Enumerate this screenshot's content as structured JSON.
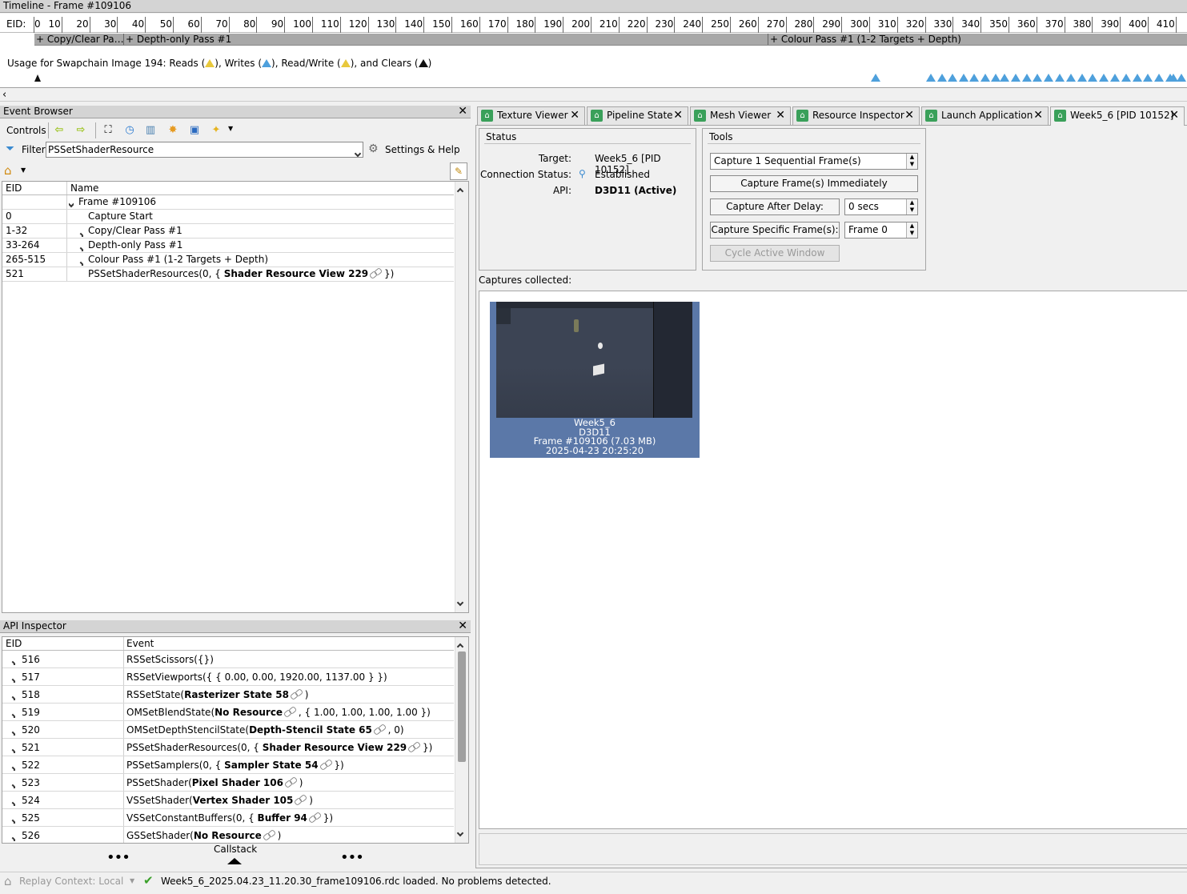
{
  "timeline": {
    "title": "Timeline - Frame #109106",
    "eid_label": "EID:",
    "ticks": [
      "0",
      "10",
      "20",
      "30",
      "40",
      "50",
      "60",
      "70",
      "80",
      "90",
      "100",
      "110",
      "120",
      "130",
      "140",
      "150",
      "160",
      "170",
      "180",
      "190",
      "200",
      "210",
      "220",
      "230",
      "240",
      "250",
      "260",
      "270",
      "280",
      "290",
      "300",
      "310",
      "320",
      "330",
      "340",
      "350",
      "360",
      "370",
      "380",
      "390",
      "400",
      "410"
    ],
    "markers": [
      "+ Copy/Clear Pa…",
      "+ Depth-only Pass #1",
      "+ Colour Pass #1 (1-2 Targets + Depth)"
    ],
    "usage_text": "Usage for Swapchain Image 194: Reads (",
    "usage_writes": "), Writes (",
    "usage_rw": "), Read/Write (",
    "usage_clears": "), and Clears (",
    "usage_end": ")"
  },
  "event_browser": {
    "title": "Event Browser",
    "controls_label": "Controls",
    "filter_label": "Filter",
    "filter_value": "PSSetShaderResource",
    "settings_label": "Settings & Help",
    "col_eid": "EID",
    "col_name": "Name",
    "rows": [
      {
        "eid": "",
        "name": "Frame #109106"
      },
      {
        "eid": "0",
        "name": "Capture Start"
      },
      {
        "eid": "1-32",
        "name": "Copy/Clear Pass #1"
      },
      {
        "eid": "33-264",
        "name": "Depth-only Pass #1"
      },
      {
        "eid": "265-515",
        "name": "Colour Pass #1 (1-2 Targets + Depth)"
      },
      {
        "eid": "521",
        "name_pre": "PSSetShaderResources(0, { ",
        "name_bold": "Shader Resource View 229",
        "name_post": " })"
      }
    ]
  },
  "api_inspector": {
    "title": "API Inspector",
    "col_eid": "EID",
    "col_event": "Event",
    "rows": [
      {
        "eid": "516",
        "pre": "RSSetScissors({})",
        "bold": "",
        "post": ""
      },
      {
        "eid": "517",
        "pre": "RSSetViewports({ { 0.00, 0.00, 1920.00, 1137.00 } })",
        "bold": "",
        "post": ""
      },
      {
        "eid": "518",
        "pre": "RSSetState(",
        "bold": "Rasterizer State 58",
        "post": " )"
      },
      {
        "eid": "519",
        "pre": "OMSetBlendState(",
        "bold": "No Resource",
        "post": " , { 1.00, 1.00, 1.00, 1.00 })"
      },
      {
        "eid": "520",
        "pre": "OMSetDepthStencilState(",
        "bold": "Depth-Stencil State 65",
        "post": " , 0)"
      },
      {
        "eid": "521",
        "pre": "PSSetShaderResources(0, { ",
        "bold": "Shader Resource View 229",
        "post": "  })"
      },
      {
        "eid": "522",
        "pre": "PSSetSamplers(0, { ",
        "bold": "Sampler State 54",
        "post": "  })"
      },
      {
        "eid": "523",
        "pre": "PSSetShader(",
        "bold": "Pixel Shader 106",
        "post": " )"
      },
      {
        "eid": "524",
        "pre": "VSSetShader(",
        "bold": "Vertex Shader 105",
        "post": " )"
      },
      {
        "eid": "525",
        "pre": "VSSetConstantBuffers(0, { ",
        "bold": "Buffer 94",
        "post": "  })"
      },
      {
        "eid": "526",
        "pre": "GSSetShader(",
        "bold": "No Resource",
        "post": " )"
      }
    ],
    "callstack_label": "Callstack"
  },
  "tabs": [
    "Texture Viewer",
    "Pipeline State",
    "Mesh Viewer",
    "Resource Inspector",
    "Launch Application",
    "Week5_6 [PID 10152]"
  ],
  "status": {
    "title": "Status",
    "target_label": "Target:",
    "target_value": "Week5_6 [PID 10152]",
    "conn_label": "Connection Status:",
    "conn_value": "Established",
    "api_label": "API:",
    "api_value": "D3D11 (Active)"
  },
  "tools": {
    "title": "Tools",
    "capture_count": "Capture 1 Sequential Frame(s)",
    "capture_now": "Capture Frame(s) Immediately",
    "capture_delay": "Capture After Delay:",
    "delay_value": "0 secs",
    "capture_specific": "Capture Specific Frame(s):",
    "frame_value": "Frame 0",
    "cycle": "Cycle Active Window"
  },
  "captures": {
    "label": "Captures collected:",
    "item": {
      "name": "Week5_6",
      "api": "D3D11",
      "frame": "Frame #109106 (7.03 MB)",
      "date": "2025-04-23 20:25:20"
    }
  },
  "statusbar": {
    "replay_context": "Replay Context: Local",
    "message": "Week5_6_2025.04.23_11.20.30_frame109106.rdc loaded. No problems detected."
  }
}
